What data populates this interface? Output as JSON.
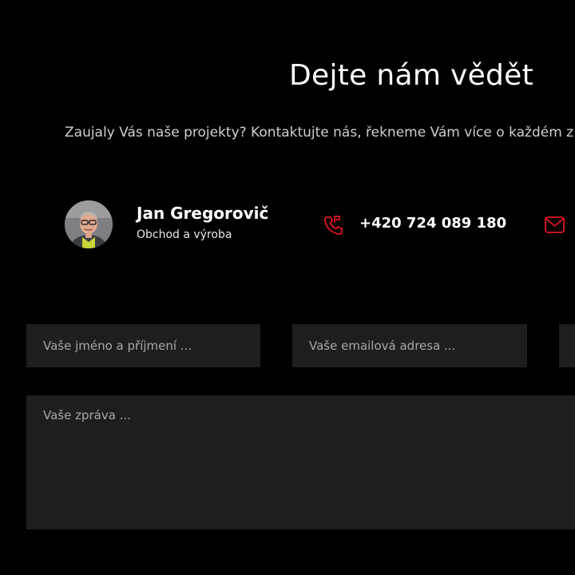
{
  "heading": {
    "title": "Dejte nám vědět",
    "subtitle": "Zaujaly Vás naše projekty? Kontaktujte nás, řekneme Vám více o každém z nich."
  },
  "contact": {
    "name": "Jan Gregorovič",
    "role": "Obchod a výroba",
    "phone": "+420 724 089 180",
    "phone_icon": "phone-icon",
    "mail_icon": "mail-icon",
    "accent_color": "#e3141f"
  },
  "form": {
    "name_placeholder": "Vaše jméno a příjmení ...",
    "email_placeholder": "Vaše emailová adresa ...",
    "message_placeholder": "Vaše zpráva ..."
  }
}
